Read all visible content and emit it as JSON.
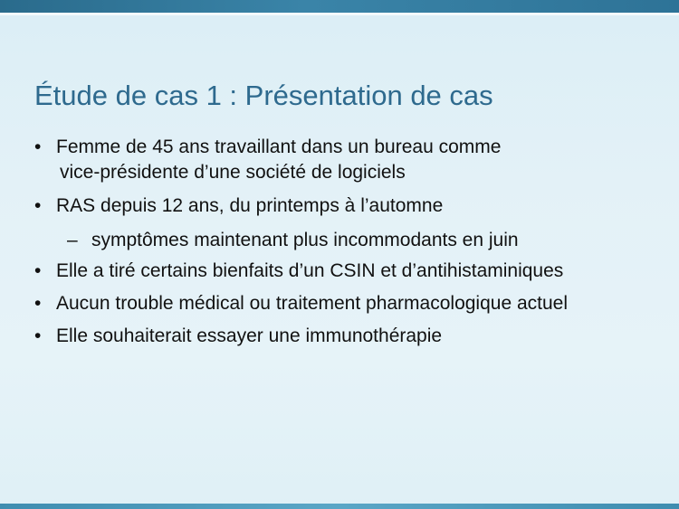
{
  "slide": {
    "title": "Étude de cas 1 : Présentation de cas",
    "bullet_marker": "•",
    "dash_marker": "–",
    "items": [
      {
        "line1": "Femme de 45 ans travaillant dans un bureau comme",
        "line2": "vice-présidente d’une société de logiciels"
      },
      {
        "line1": "RAS depuis 12 ans, du printemps à l’automne"
      },
      {
        "sub": "symptômes maintenant plus incommodants en juin"
      },
      {
        "line1": "Elle a tiré certains bienfaits d’un CSIN et d’antihistaminiques"
      },
      {
        "line1": "Aucun trouble médical ou traitement pharmacologique actuel"
      },
      {
        "line1": "Elle souhaiterait essayer une immunothérapie"
      }
    ]
  },
  "colors": {
    "title": "#2e6a8e",
    "top_bar": "#2a6b8c",
    "background": "#e3f1f7"
  }
}
